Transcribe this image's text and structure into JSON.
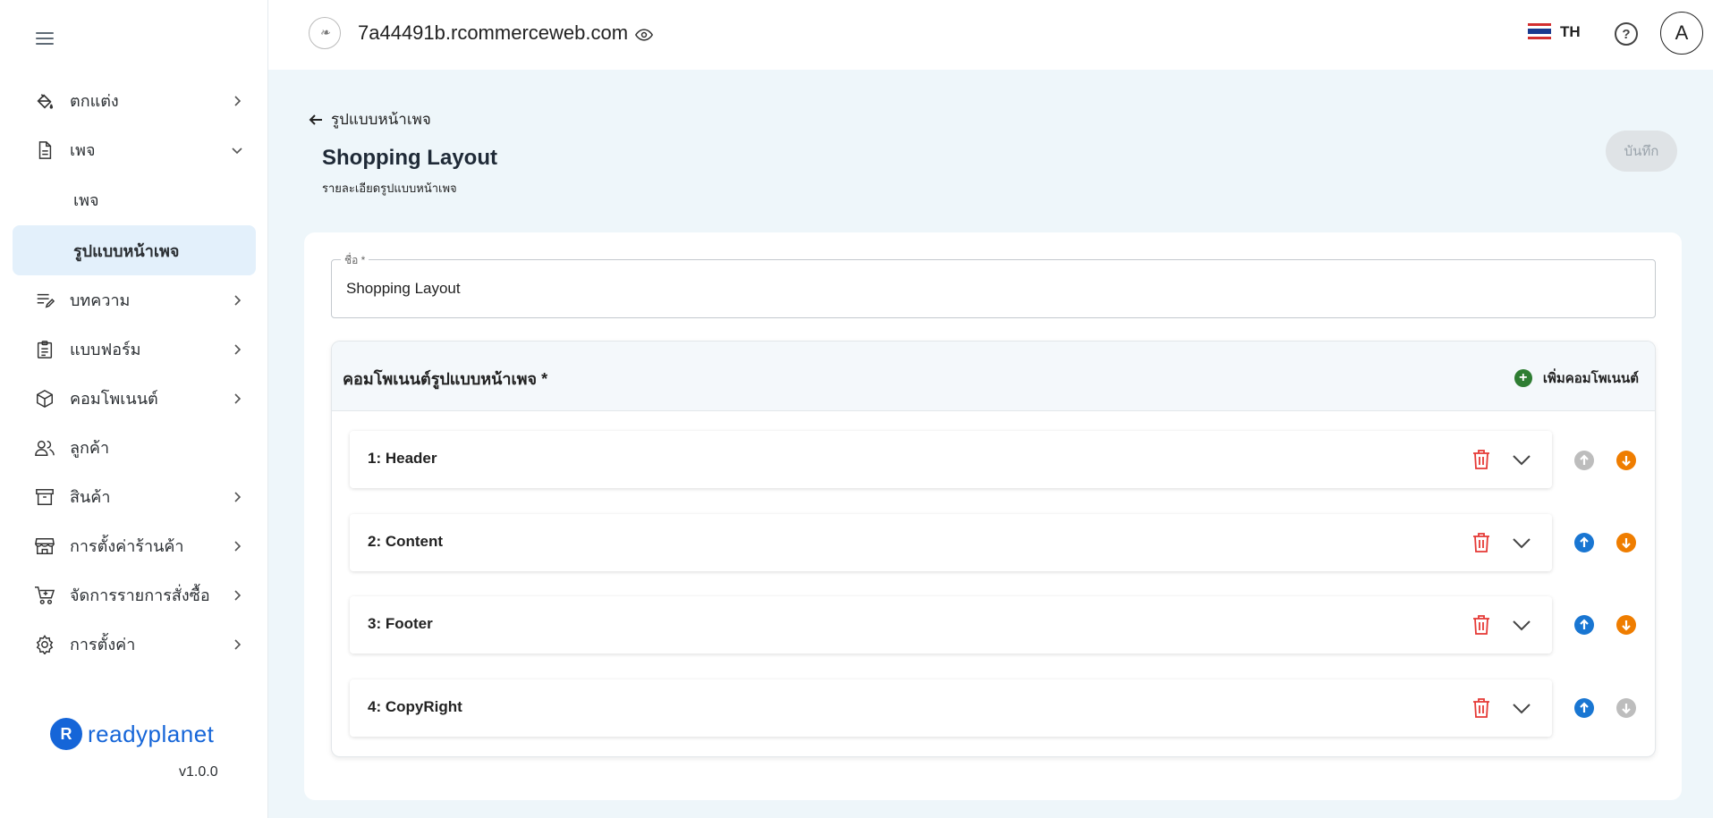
{
  "sidebar": {
    "items": [
      {
        "label": "ตกแต่ง",
        "icon": "paint-bucket-icon"
      },
      {
        "label": "เพจ",
        "icon": "document-icon"
      },
      {
        "label": "บทความ",
        "icon": "article-edit-icon"
      },
      {
        "label": "แบบฟอร์ม",
        "icon": "clipboard-form-icon"
      },
      {
        "label": "คอมโพเนนต์",
        "icon": "cube-icon"
      },
      {
        "label": "ลูกค้า",
        "icon": "users-icon"
      },
      {
        "label": "สินค้า",
        "icon": "archive-box-icon"
      },
      {
        "label": "การตั้งค่าร้านค้า",
        "icon": "store-icon"
      },
      {
        "label": "จัดการรายการสั่งซื้อ",
        "icon": "cart-icon"
      },
      {
        "label": "การตั้งค่า",
        "icon": "gear-icon"
      }
    ],
    "sub_items": [
      {
        "label": "เพจ"
      },
      {
        "label": "รูปแบบหน้าเพจ"
      }
    ],
    "brand_name": "readyplanet",
    "brand_mark": "R",
    "version": "v1.0.0"
  },
  "topbar": {
    "site_name": "7a44491b.rcommerceweb.com",
    "language": "TH",
    "help": "?",
    "avatar_initial": "A"
  },
  "main": {
    "back_label": "รูปแบบหน้าเพจ",
    "title": "Shopping Layout",
    "subtitle": "รายละเอียดรูปแบบหน้าเพจ",
    "save_label": "บันทึก",
    "name_field": {
      "label": "ชื่อ *",
      "value": "Shopping Layout"
    },
    "components_title": "คอมโพเนนต์รูปแบบหน้าเพจ *",
    "add_component_label": "เพิ่มคอมโพเนนต์",
    "components": [
      {
        "label": "1: Header",
        "up_enabled": false,
        "down_enabled": true
      },
      {
        "label": "2: Content",
        "up_enabled": true,
        "down_enabled": true
      },
      {
        "label": "3: Footer",
        "up_enabled": true,
        "down_enabled": true
      },
      {
        "label": "4: CopyRight",
        "up_enabled": true,
        "down_enabled": false
      }
    ]
  },
  "colors": {
    "accent_blue": "#1976d2",
    "move_down_orange": "#ef7d00",
    "disabled_gray": "#bdbdbd",
    "delete_red": "#e53935",
    "add_green": "#2e7d32",
    "active_nav_bg": "#e3f0fb",
    "brand_blue": "#1565d8"
  }
}
